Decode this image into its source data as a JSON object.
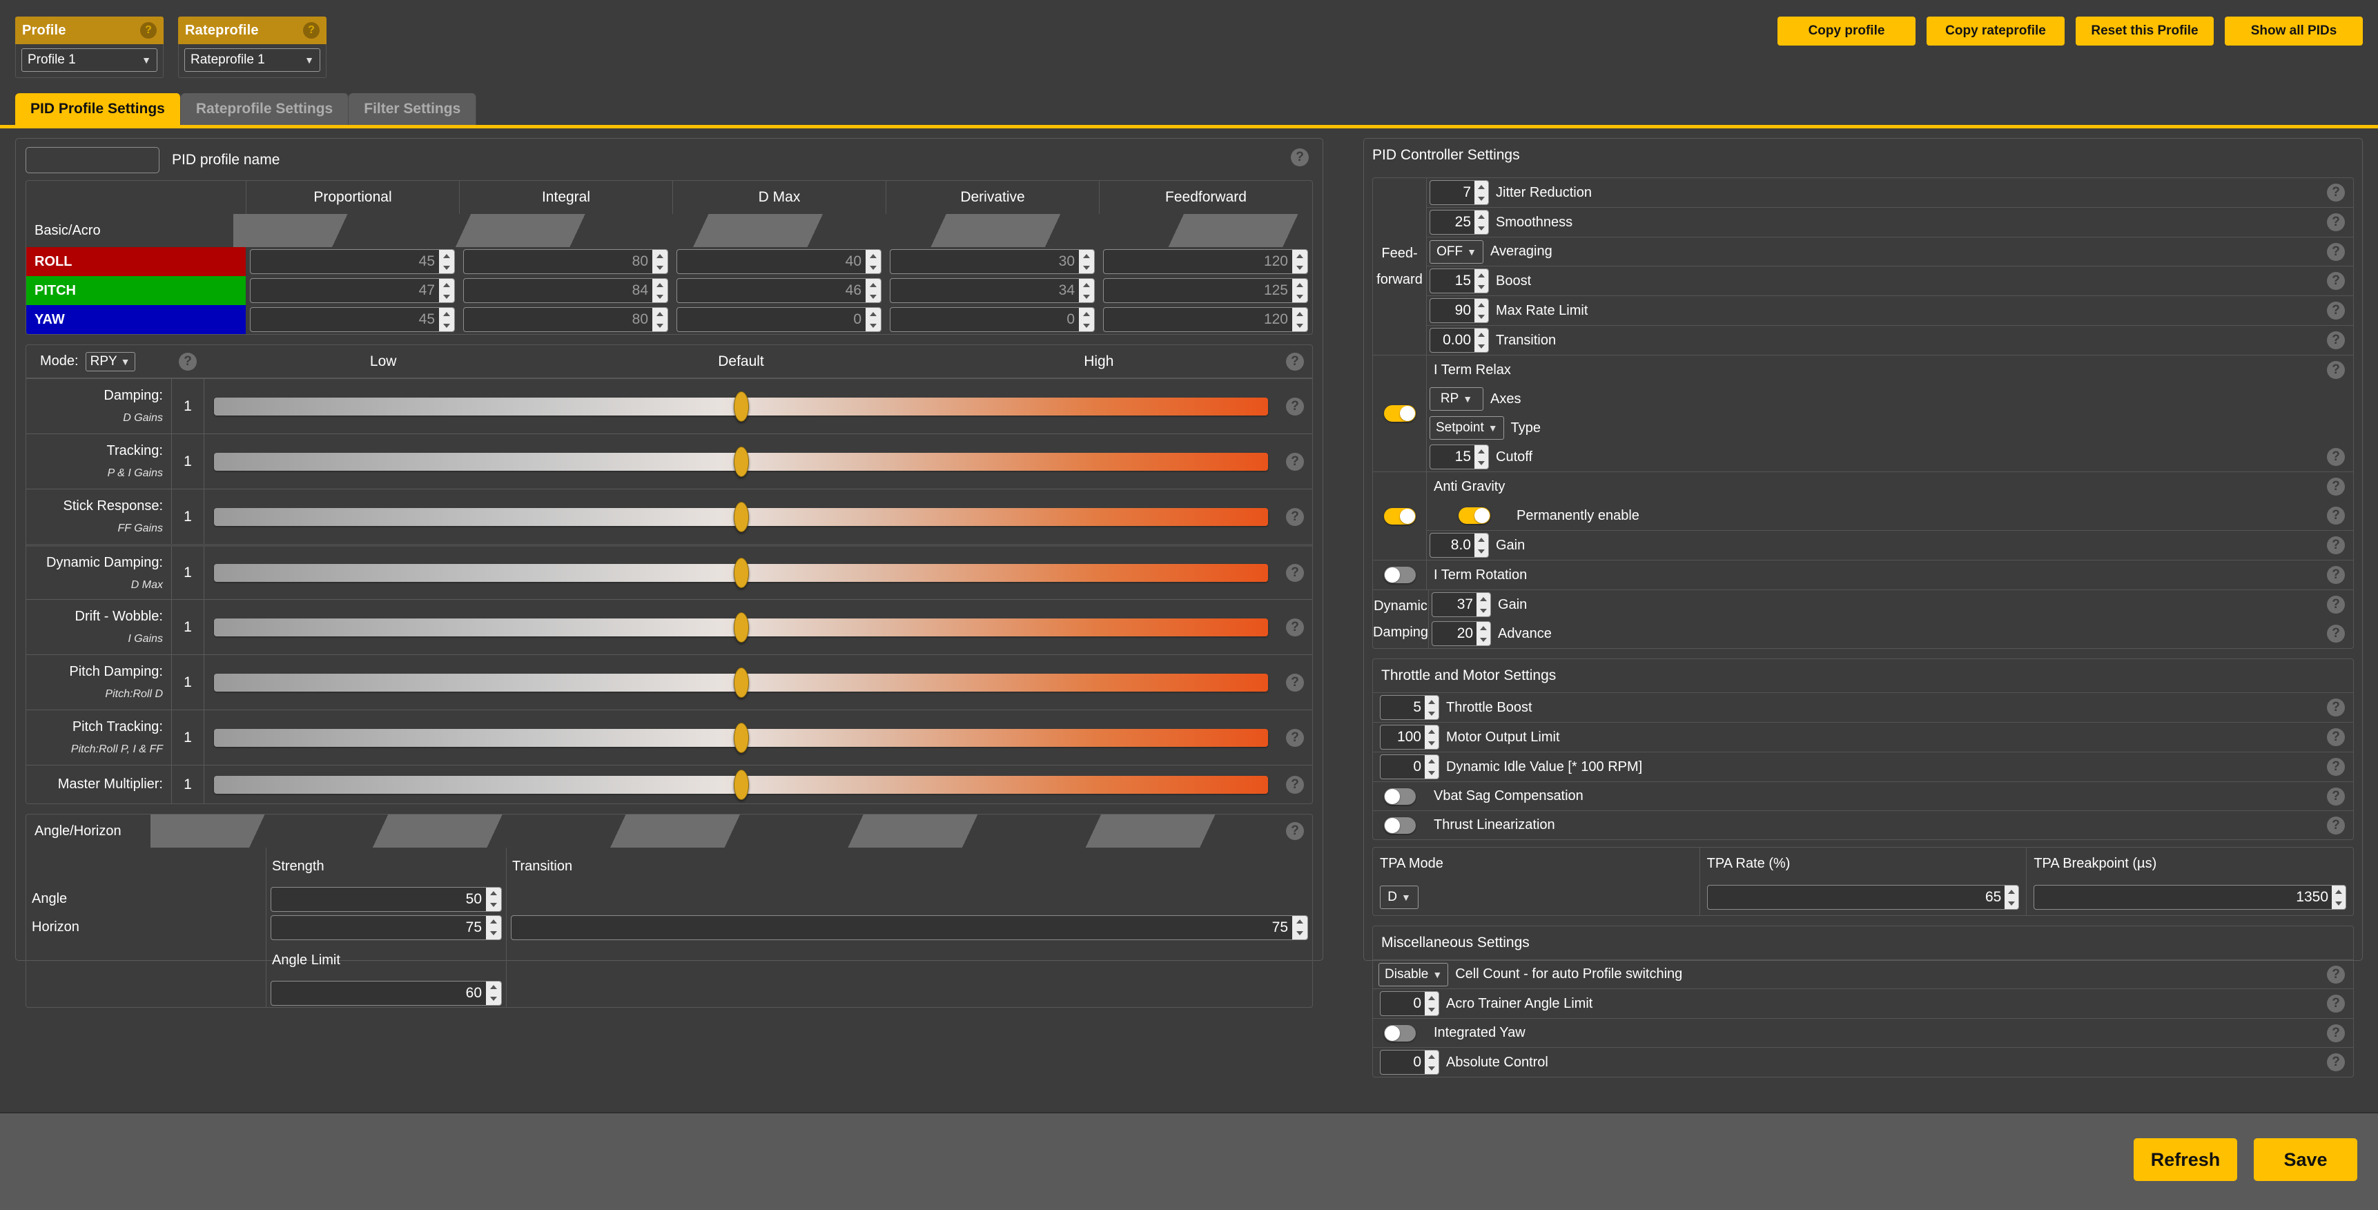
{
  "header": {
    "profile": {
      "title": "Profile",
      "selected": "Profile 1",
      "help": "?"
    },
    "rateprofile": {
      "title": "Rateprofile",
      "selected": "Rateprofile 1",
      "help": "?"
    },
    "buttons": [
      {
        "label": "Copy profile"
      },
      {
        "label": "Copy rateprofile"
      },
      {
        "label": "Reset this Profile"
      },
      {
        "label": "Show all PIDs"
      }
    ]
  },
  "tabs": [
    {
      "label": "PID Profile Settings",
      "active": true
    },
    {
      "label": "Rateprofile Settings",
      "active": false
    },
    {
      "label": "Filter Settings",
      "active": false
    }
  ],
  "profile_name": {
    "value": "",
    "label": "PID profile name"
  },
  "pid_table": {
    "columns": [
      "",
      "Proportional",
      "Integral",
      "D Max",
      "Derivative",
      "Feedforward"
    ],
    "group_label": "Basic/Acro",
    "rows": [
      {
        "axis": "ROLL",
        "color": "#b00000",
        "values": [
          "45",
          "80",
          "40",
          "30",
          "120"
        ]
      },
      {
        "axis": "PITCH",
        "color": "#00a800",
        "values": [
          "47",
          "84",
          "46",
          "34",
          "125"
        ]
      },
      {
        "axis": "YAW",
        "color": "#0000bb",
        "values": [
          "45",
          "80",
          "0",
          "0",
          "120"
        ]
      }
    ]
  },
  "sliders": {
    "mode_label": "Mode:",
    "mode_value": "RPY",
    "scale_low": "Low",
    "scale_default": "Default",
    "scale_high": "High",
    "rows": [
      {
        "name": "Damping:",
        "sub": "D Gains",
        "value": "1",
        "pos": 50,
        "group": 0
      },
      {
        "name": "Tracking:",
        "sub": "P & I Gains",
        "value": "1",
        "pos": 50,
        "group": 0
      },
      {
        "name": "Stick Response:",
        "sub": "FF Gains",
        "value": "1",
        "pos": 50,
        "group": 0
      },
      {
        "name": "Dynamic Damping:",
        "sub": "D Max",
        "value": "1",
        "pos": 50,
        "group": 1
      },
      {
        "name": "Drift - Wobble:",
        "sub": "I Gains",
        "value": "1",
        "pos": 50,
        "group": 1
      },
      {
        "name": "Pitch Damping:",
        "sub": "Pitch:Roll D",
        "value": "1",
        "pos": 50,
        "group": 1
      },
      {
        "name": "Pitch Tracking:",
        "sub": "Pitch:Roll P, I & FF",
        "value": "1",
        "pos": 50,
        "group": 1
      },
      {
        "name": "Master Multiplier:",
        "sub": "",
        "value": "1",
        "pos": 50,
        "group": 1
      }
    ]
  },
  "angle_horizon": {
    "title": "Angle/Horizon",
    "col_strength": "Strength",
    "col_transition": "Transition",
    "row_angle": "Angle",
    "row_horizon": "Horizon",
    "angle_limit_label": "Angle Limit",
    "angle_strength": "50",
    "horizon_strength": "75",
    "horizon_transition": "75",
    "angle_limit": "60"
  },
  "pid_controller": {
    "title": "PID Controller Settings",
    "feedforward_label_1": "Feed-",
    "feedforward_label_2": "forward",
    "feedforward": [
      {
        "label": "Jitter Reduction",
        "value": "7",
        "type": "spin"
      },
      {
        "label": "Smoothness",
        "value": "25",
        "type": "spin"
      },
      {
        "label": "Averaging",
        "value": "OFF",
        "type": "select"
      },
      {
        "label": "Boost",
        "value": "15",
        "type": "spin"
      },
      {
        "label": "Max Rate Limit",
        "value": "90",
        "type": "spin"
      },
      {
        "label": "Transition",
        "value": "0.00",
        "type": "spin"
      }
    ],
    "iterm_relax": {
      "title": "I Term Relax",
      "enabled": true,
      "rows": [
        {
          "label": "Axes",
          "value": "RP",
          "type": "select"
        },
        {
          "label": "Type",
          "value": "Setpoint",
          "type": "select"
        },
        {
          "label": "Cutoff",
          "value": "15",
          "type": "spin"
        }
      ]
    },
    "anti_gravity": {
      "title": "Anti Gravity",
      "enabled": true,
      "permanently_enable_label": "Permanently enable",
      "permanently_enable": true,
      "gain_label": "Gain",
      "gain": "8.0"
    },
    "iterm_rotation": {
      "title": "I Term Rotation",
      "enabled": false
    },
    "dynamic_damping": {
      "label_1": "Dynamic",
      "label_2": "Damping",
      "rows": [
        {
          "label": "Gain",
          "value": "37"
        },
        {
          "label": "Advance",
          "value": "20"
        }
      ]
    }
  },
  "throttle_motor": {
    "title": "Throttle and Motor Settings",
    "rows": [
      {
        "label": "Throttle Boost",
        "value": "5",
        "type": "spin"
      },
      {
        "label": "Motor Output Limit",
        "value": "100",
        "type": "spin"
      },
      {
        "label": "Dynamic Idle Value [* 100 RPM]",
        "value": "0",
        "type": "spin"
      },
      {
        "label": "Vbat Sag Compensation",
        "enabled": false,
        "type": "toggle"
      },
      {
        "label": "Thrust Linearization",
        "enabled": false,
        "type": "toggle"
      }
    ]
  },
  "tpa": {
    "mode_label": "TPA Mode",
    "mode_value": "D",
    "rate_label": "TPA Rate (%)",
    "rate_value": "65",
    "breakpoint_label": "TPA Breakpoint (µs)",
    "breakpoint_value": "1350"
  },
  "misc": {
    "title": "Miscellaneous Settings",
    "rows": [
      {
        "label": "Cell Count - for auto Profile switching",
        "value": "Disable",
        "type": "select"
      },
      {
        "label": "Acro Trainer Angle Limit",
        "value": "0",
        "type": "spin"
      },
      {
        "label": "Integrated Yaw",
        "enabled": false,
        "type": "toggle"
      },
      {
        "label": "Absolute Control",
        "value": "0",
        "type": "spin"
      }
    ]
  },
  "footer": {
    "refresh_label": "Refresh",
    "save_label": "Save"
  },
  "colors": {
    "accent": "#ffc000",
    "header_gold": "#bf8c13",
    "background": "#3c3c3c",
    "footer": "#5a5a5a",
    "roll": "#b00000",
    "pitch": "#00a800",
    "yaw": "#0000bb"
  }
}
